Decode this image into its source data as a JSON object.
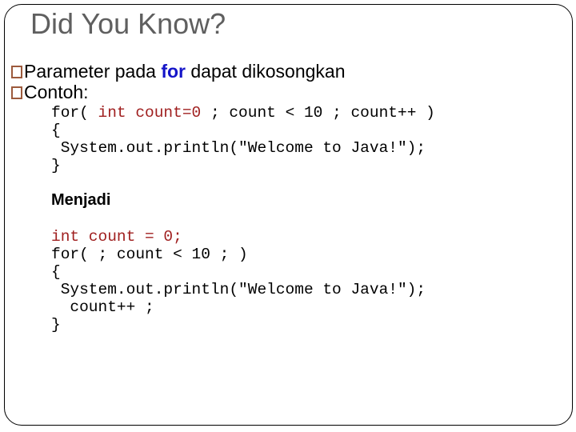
{
  "slide": {
    "title": "Did You Know?",
    "bullets": [
      {
        "icon": "square-bullet-icon",
        "text_before": "Parameter pada ",
        "keyword": "for",
        "text_after": " dapat dikosongkan"
      },
      {
        "icon": "square-bullet-icon",
        "text": "Contoh:"
      }
    ],
    "example_code": {
      "line1_plain_start": "for( ",
      "line1_highlight": "int count=0",
      "line1_plain_end": " ; count < 10 ; count++ )",
      "line2": "{",
      "line3": " System.out.println(\"Welcome to Java!\");",
      "line4": "}"
    },
    "transition_label": "Menjadi",
    "result_code": {
      "line1_highlight": "int count = 0;",
      "line2": "for( ; count < 10 ; )",
      "line3": "{",
      "line4": " System.out.println(\"Welcome to Java!\");",
      "line5": "  count++ ;",
      "line6": "}"
    },
    "colors": {
      "title": "#5f5f5f",
      "keyword_for": "#1414c8",
      "code_highlight": "#a02020",
      "bullet_box": "#9c5a3c"
    }
  }
}
